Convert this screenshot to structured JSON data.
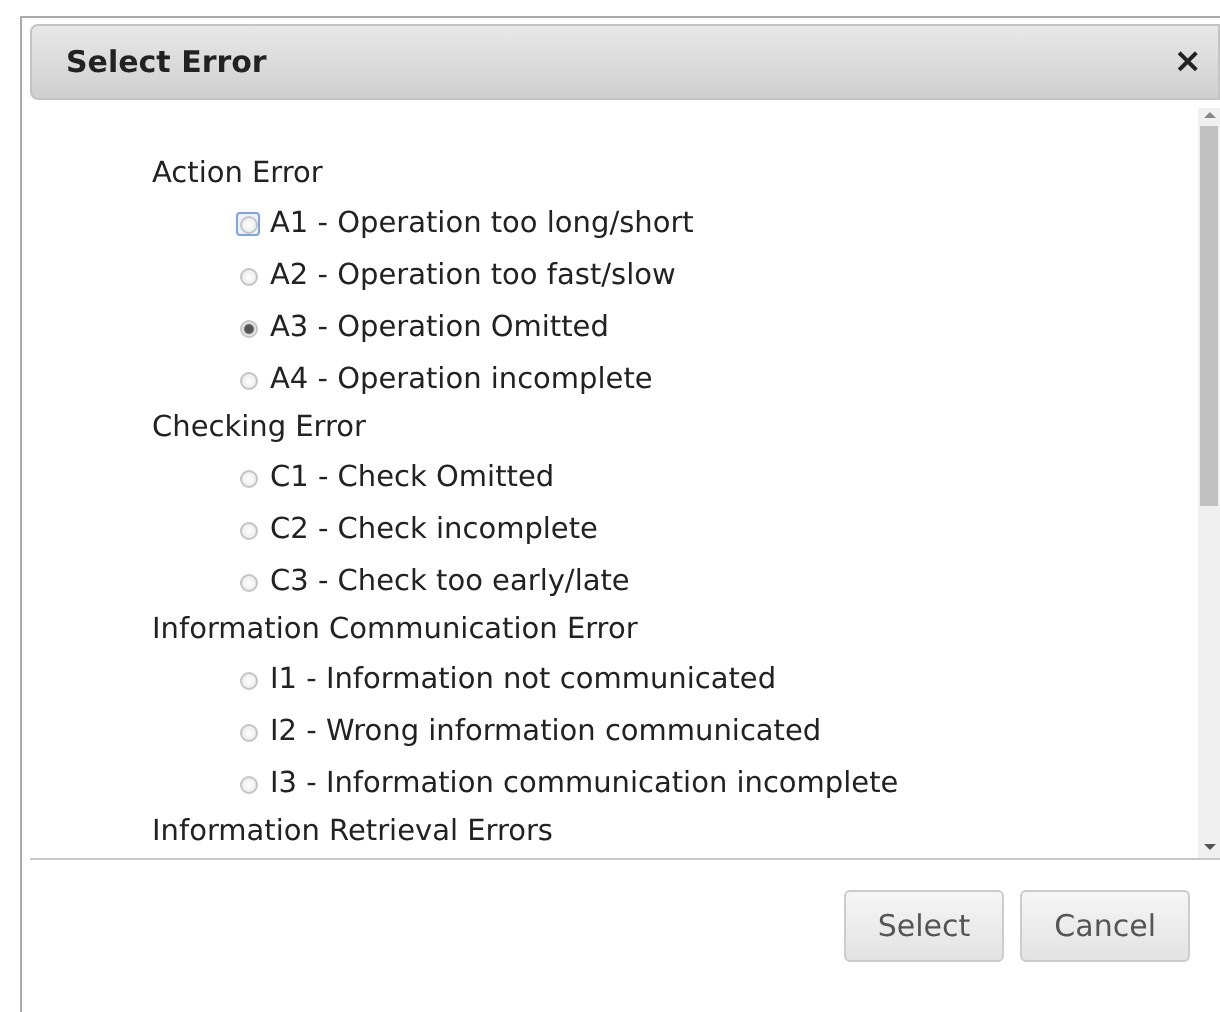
{
  "dialog": {
    "title": "Select Error",
    "close_glyph": "×"
  },
  "groups": [
    {
      "label": "Action Error",
      "options": [
        {
          "label": "A1 - Operation too long/short",
          "selected": false,
          "focused": true
        },
        {
          "label": "A2 - Operation too fast/slow",
          "selected": false,
          "focused": false
        },
        {
          "label": "A3 - Operation Omitted",
          "selected": true,
          "focused": false
        },
        {
          "label": "A4 - Operation incomplete",
          "selected": false,
          "focused": false
        }
      ]
    },
    {
      "label": "Checking Error",
      "options": [
        {
          "label": "C1 - Check Omitted",
          "selected": false,
          "focused": false
        },
        {
          "label": "C2 - Check incomplete",
          "selected": false,
          "focused": false
        },
        {
          "label": "C3 - Check too early/late",
          "selected": false,
          "focused": false
        }
      ]
    },
    {
      "label": "Information Communication Error",
      "options": [
        {
          "label": "I1 - Information not communicated",
          "selected": false,
          "focused": false
        },
        {
          "label": "I2 - Wrong information communicated",
          "selected": false,
          "focused": false
        },
        {
          "label": "I3 - Information communication incomplete",
          "selected": false,
          "focused": false
        }
      ]
    },
    {
      "label": "Information Retrieval Errors"
    }
  ],
  "buttons": [
    "Select",
    "Cancel"
  ]
}
